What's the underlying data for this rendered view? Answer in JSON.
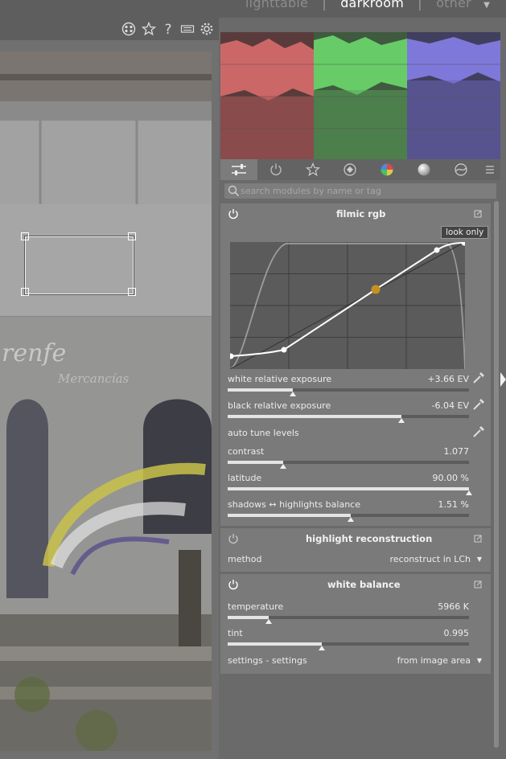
{
  "views": {
    "lighttable": "lighttable",
    "darkroom": "darkroom",
    "other": "other",
    "separator": "|"
  },
  "search": {
    "placeholder": "search modules by name or tag"
  },
  "filmic": {
    "title": "filmic rgb",
    "badge": "look only",
    "white_exposure": {
      "label": "white relative exposure",
      "value": "+3.66 EV",
      "fraction": 0.27
    },
    "black_exposure": {
      "label": "black relative exposure",
      "value": "-6.04 EV",
      "fraction": 0.72
    },
    "auto_tune": "auto tune levels",
    "contrast": {
      "label": "contrast",
      "value": "1.077",
      "fraction": 0.23
    },
    "latitude": {
      "label": "latitude",
      "value": "90.00 %",
      "fraction": 1.0
    },
    "balance": {
      "label": "shadows ↔ highlights balance",
      "value": "1.51 %",
      "fraction": 0.51
    }
  },
  "highlight": {
    "title": "highlight reconstruction",
    "method_label": "method",
    "method_value": "reconstruct in LCh"
  },
  "wb": {
    "title": "white balance",
    "temperature": {
      "label": "temperature",
      "value": "5966 K",
      "fraction": 0.17
    },
    "tint": {
      "label": "tint",
      "value": "0.995",
      "fraction": 0.39
    },
    "settings_label": "settings - settings",
    "settings_value": "from image area"
  },
  "photo": {
    "logo": "renfe",
    "sub": "Mercancías"
  },
  "icons": [
    "grid-icon",
    "star-icon",
    "help-icon",
    "keyboard-icon",
    "gear-icon"
  ],
  "colors": {
    "accent_orange": "#c8901e",
    "histogram_red": "#e07070",
    "histogram_green": "#6fe06f",
    "histogram_blue": "#8a82f0"
  }
}
